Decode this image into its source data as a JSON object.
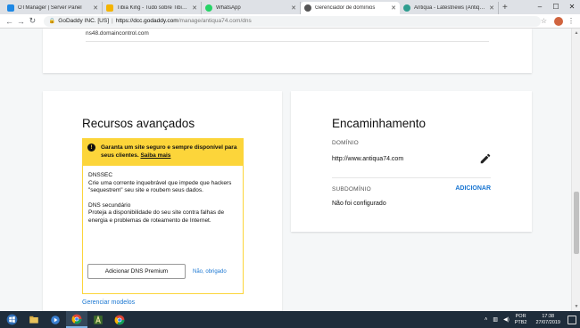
{
  "browser": {
    "tabs": [
      {
        "label": "OTManager | Server Panel",
        "color": "#1e88e5"
      },
      {
        "label": "Tibia King - Tudo sobre Tibia, ...",
        "color": "#f4b400"
      },
      {
        "label": "WhatsApp",
        "color": "#25d366"
      },
      {
        "label": "Gerenciador de domínios",
        "color": "#555555"
      },
      {
        "label": "Antiqua - Latestnews (Antiqua)...",
        "color": "#2e9d8f"
      }
    ],
    "address": {
      "origin": "GoDaddy INC. [US]",
      "host": "https://dcc.godaddy.com",
      "path": "/manage/antiqua74.com/dns"
    }
  },
  "top_card": {
    "nameserver": "ns48.domaincontrol.com"
  },
  "advanced": {
    "title": "Recursos avançados",
    "promo": {
      "headline": "Garanta um site seguro e sempre disponível para seus clientes.",
      "learn_more": "Saiba mais",
      "dnssec_title": "DNSSEC",
      "dnssec_desc": "Crie uma corrente inquebrável que impede que hackers \"sequestrem\" seu site e roubem seus dados.",
      "secondary_title": "DNS secundário",
      "secondary_desc": "Proteja a disponibilidade do seu site contra falhas de energia e problemas de roteamento de Internet.",
      "button": "Adicionar DNS Premium",
      "decline": "Não, obrigado"
    },
    "manage_models": "Gerenciar modelos"
  },
  "forwarding": {
    "title": "Encaminhamento",
    "domain_label": "DOMÍNIO",
    "domain_value": "http://www.antiqua74.com",
    "subdomain_label": "SUBDOMÍNIO",
    "subdomain_add": "ADICIONAR",
    "subdomain_value": "Não foi configurado"
  },
  "taskbar": {
    "lang_top": "POR",
    "lang_bottom": "PTB2",
    "time": "17:38",
    "date": "27/07/2019"
  },
  "colors": {
    "accent_link": "#1976d2",
    "promo_yellow": "#fcd53a",
    "taskbar": "#1f2d3b"
  }
}
